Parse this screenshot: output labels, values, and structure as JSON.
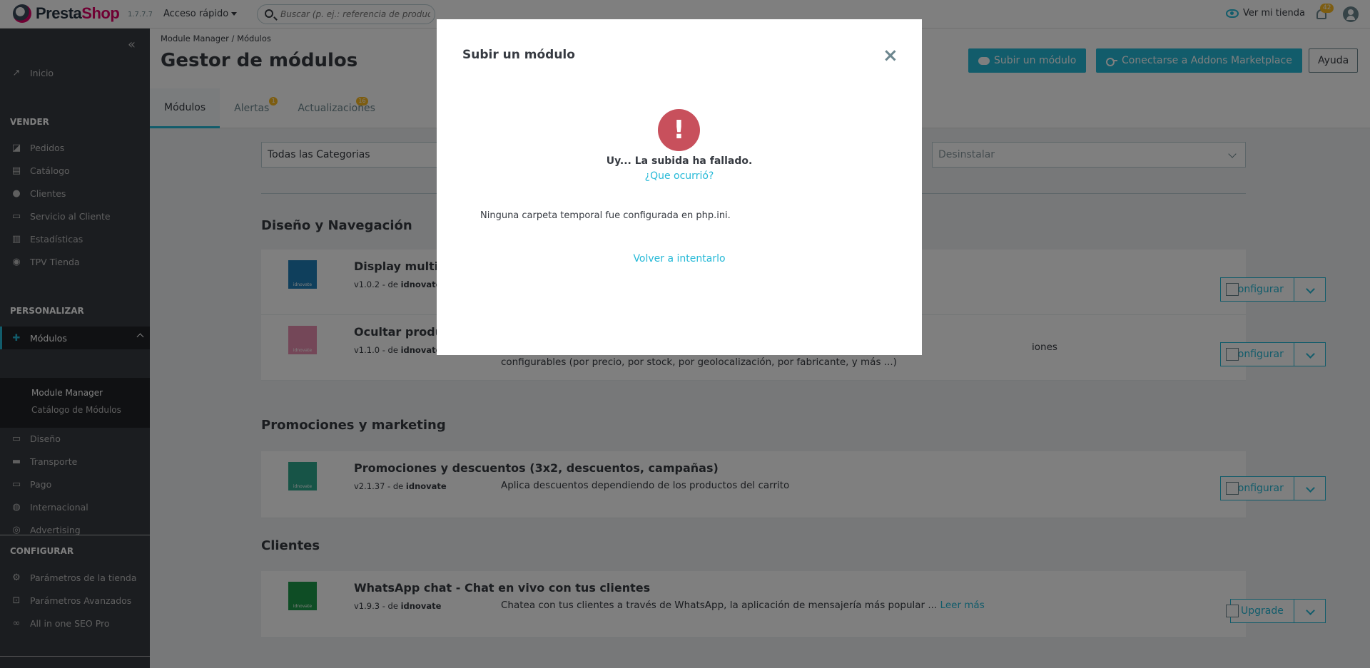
{
  "header": {
    "logo_presta": "Presta",
    "logo_shop": "Shop",
    "version": "1.7.7.7",
    "quick_access": "Acceso rápido",
    "search_placeholder": "Buscar (p. ej.: referencia de producto, no",
    "view_store": "Ver mi tienda",
    "notifications_count": "42"
  },
  "sidebar": {
    "collapse": "«",
    "items": {
      "inicio": "Inicio",
      "pedidos": "Pedidos",
      "catalogo": "Catálogo",
      "clientes": "Clientes",
      "servicio": "Servicio al Cliente",
      "estadisticas": "Estadísticas",
      "tpv": "TPV Tienda",
      "modulos": "Módulos",
      "module_manager": "Module Manager",
      "catalogo_modulos": "Catálogo de Módulos",
      "diseno": "Diseño",
      "transporte": "Transporte",
      "pago": "Pago",
      "internacional": "Internacional",
      "advertising": "Advertising",
      "parametros_tienda": "Parámetros de la tienda",
      "parametros_avanzados": "Parámetros Avanzados",
      "seo": "All in one SEO Pro"
    },
    "sections": {
      "vender": "VENDER",
      "personalizar": "PERSONALIZAR",
      "configurar": "CONFIGURAR"
    }
  },
  "page": {
    "breadcrumb_1": "Module Manager",
    "breadcrumb_sep": "/",
    "breadcrumb_2": "Módulos",
    "title": "Gestor de módulos",
    "upload_button": "Subir un módulo",
    "addons_button": "Conectarse a Addons Marketplace",
    "help_button": "Ayuda",
    "tabs": {
      "modulos": "Módulos",
      "alertas": "Alertas",
      "alertas_badge": "1",
      "actualizaciones": "Actualizaciones",
      "actualizaciones_badge": "16"
    }
  },
  "filters": {
    "category_value": "Todas las Categorias",
    "action_value": "Desinstalar"
  },
  "categories": [
    {
      "title": "Diseño y Navegación",
      "modules": [
        {
          "name": "Display multip",
          "version": "v1.0.2 - de",
          "author": "idnovate",
          "desc": "",
          "more": "",
          "button": "Configurar"
        },
        {
          "name": "Ocultar produc",
          "version": "v1.1.0 - de",
          "author": "idnovate",
          "desc": "configurables (por precio, por stock, por geolocalización, por fabricante, y más ...)",
          "desc_tail": "iones",
          "more": "",
          "button": "Configurar"
        }
      ]
    },
    {
      "title": "Promociones y marketing",
      "modules": [
        {
          "name": "Promociones y descuentos (3x2, descuentos, campañas)",
          "version": "v2.1.37 - de",
          "author": "idnovate",
          "desc": "Aplica descuentos dependiendo de los productos del carrito",
          "more": "",
          "button": "Configurar"
        }
      ]
    },
    {
      "title": "Clientes",
      "modules": [
        {
          "name": "WhatsApp chat - Chat en vivo con tus clientes",
          "version": "v1.9.3 - de",
          "author": "idnovate",
          "desc": "Chatea con tus clientes a través de WhatsApp, la aplicación de mensajería más popular ...",
          "more": "Leer más",
          "button": "Upgrade"
        }
      ]
    }
  ],
  "logo_caption": "idnovate",
  "modal": {
    "title": "Subir un módulo",
    "close": "×",
    "error_mark": "!",
    "error_title": "Uy... La subida ha fallado.",
    "error_link": "¿Que ocurrió?",
    "error_message": "Ninguna carpeta temporal fue configurada en php.ini.",
    "retry": "Volver a intentarlo"
  },
  "colors": {
    "accent": "#25b9d7",
    "sidebar_bg": "#363a41",
    "error": "#c8505c",
    "badge": "#fbbb22"
  }
}
